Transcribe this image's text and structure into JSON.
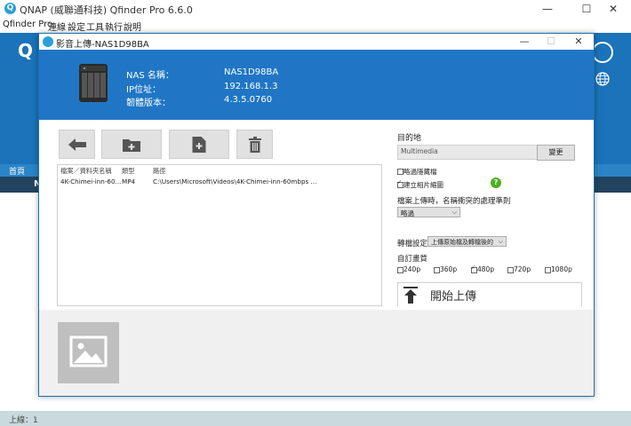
{
  "main_window": {
    "title": "QNAP (威聯通科技) Qfinder Pro 6.6.0",
    "minimize": "—",
    "maximize": "☐",
    "close": "✕",
    "menu": [
      "Qfinder Pro",
      "連線",
      "設定",
      "工具",
      "執行",
      "說明"
    ],
    "logo": "Q",
    "tab_label": "首頁",
    "dark_bar_text": "M",
    "status": "上線：1"
  },
  "dialog": {
    "title": "影音上傳-NAS1D98BA",
    "minimize": "—",
    "maximize": "☐",
    "close": "✕",
    "nas_info": {
      "name_label": "NAS 名稱：",
      "name_value": "NAS1D98BA",
      "ip_label": "IP位址：",
      "ip_value": "192.168.1.3",
      "fw_label": "韌體版本：",
      "fw_value": "4.3.5.0760"
    },
    "toolbar": [
      "back-arrow-icon",
      "add-folder-icon",
      "add-file-icon",
      "trash-icon"
    ],
    "file_list": {
      "headers": [
        "檔案／資料夾名稱",
        "類型",
        "路徑"
      ],
      "rows": [
        {
          "name": "4K-Chimei-inn-60...",
          "type": "MP4",
          "path": "C:\\Users\\Microsoft\\Videos\\4K-Chimei-inn-60mbps ..."
        }
      ]
    },
    "destination": {
      "label": "目的地",
      "value": "Multimedia",
      "change_button": "變更",
      "skip_hidden": "略過隱藏檔",
      "skip_hidden_checked": false,
      "create_thumb": "建立相片縮圖",
      "create_thumb_checked": true,
      "conflict_label": "檔案上傳時，名稱衝突的處理準則",
      "conflict_value": "略過",
      "transcode_label": "轉檔設定",
      "transcode_value": "上傳原始檔及轉檔後的",
      "custom_quality_label": "自訂畫質",
      "qualities": [
        {
          "label": "240p",
          "checked": false
        },
        {
          "label": "360p",
          "checked": false
        },
        {
          "label": "480p",
          "checked": true
        },
        {
          "label": "720p",
          "checked": false
        },
        {
          "label": "1080p",
          "checked": false
        }
      ],
      "start_upload": "開始上傳"
    }
  },
  "colors": {
    "header_blue": "#2076c5",
    "main_header_blue": "#1b73b9",
    "dark_bar": "#22445f",
    "status_bar": "#c9d9de",
    "help_green": "#4caf1f"
  }
}
